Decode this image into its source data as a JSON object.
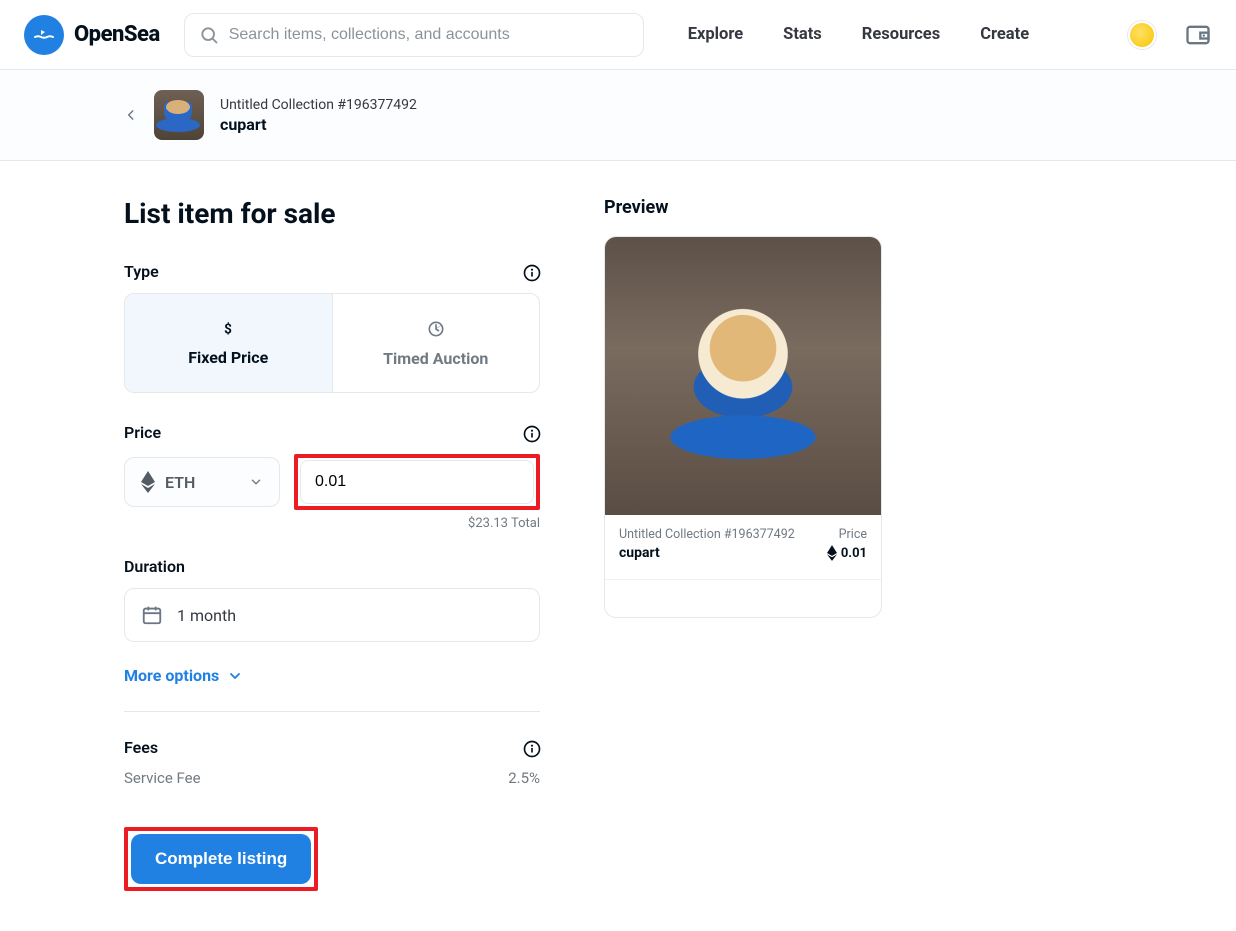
{
  "brand": "OpenSea",
  "search": {
    "placeholder": "Search items, collections, and accounts"
  },
  "nav": {
    "explore": "Explore",
    "stats": "Stats",
    "resources": "Resources",
    "create": "Create"
  },
  "crumb": {
    "collection": "Untitled Collection #196377492",
    "name": "cupart"
  },
  "page": {
    "title": "List item for sale"
  },
  "type": {
    "label": "Type",
    "fixed": "Fixed Price",
    "timed": "Timed Auction"
  },
  "price": {
    "label": "Price",
    "currency": "ETH",
    "amount": "0.01",
    "total": "$23.13 Total"
  },
  "duration": {
    "label": "Duration",
    "value": "1 month"
  },
  "more_options": "More options",
  "fees": {
    "label": "Fees",
    "service_fee_label": "Service Fee",
    "service_fee_value": "2.5%"
  },
  "complete": "Complete listing",
  "preview": {
    "title": "Preview",
    "collection": "Untitled Collection #196377492",
    "name": "cupart",
    "price_label": "Price",
    "price_value": "0.01"
  }
}
